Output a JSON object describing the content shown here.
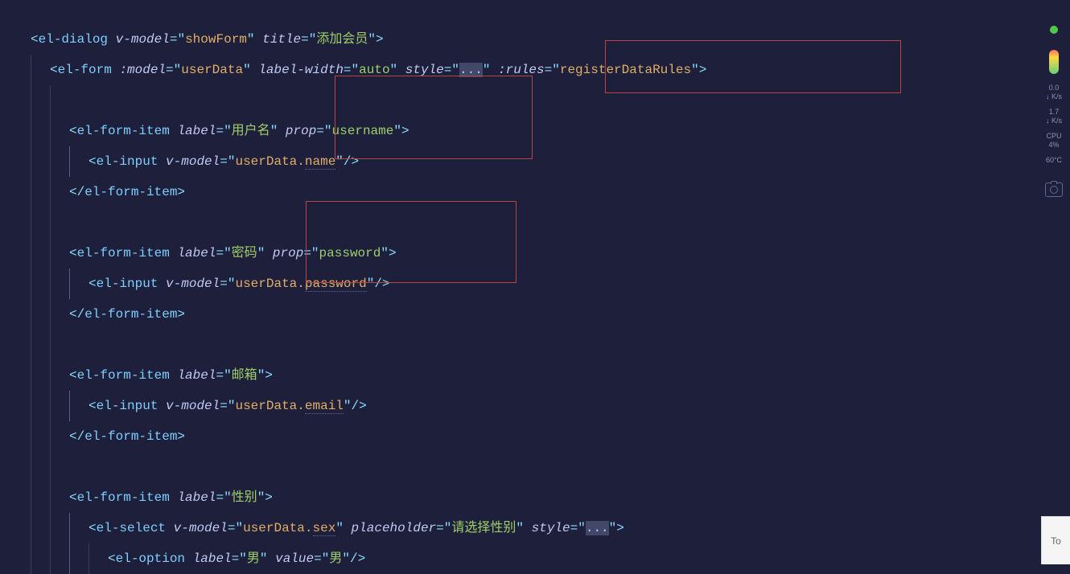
{
  "code": {
    "line1": {
      "tag": "el-dialog",
      "attr1": "v-model",
      "val1": "showForm",
      "attr2": "title",
      "val2": "添加会员"
    },
    "line2": {
      "tag": "el-form",
      "attr1": ":model",
      "val1": "userData",
      "attr2": "label-width",
      "val2": "auto",
      "attr3": "style",
      "val3": "...",
      "attr4": ":rules",
      "val4": "registerDataRules"
    },
    "line4": {
      "tag": "el-form-item",
      "attr1": "label",
      "val1": "用户名",
      "attr2": "prop",
      "val2": "username"
    },
    "line5": {
      "tag": "el-input",
      "attr1": "v-model",
      "val1a": "userData.",
      "val1b": "name"
    },
    "line6": {
      "closetag": "el-form-item"
    },
    "line8": {
      "tag": "el-form-item",
      "attr1": "label",
      "val1": "密码",
      "attr2": "prop",
      "val2": "password"
    },
    "line9": {
      "tag": "el-input",
      "attr1": "v-model",
      "val1a": "userData.",
      "val1b": "password"
    },
    "line10": {
      "closetag": "el-form-item"
    },
    "line12": {
      "tag": "el-form-item",
      "attr1": "label",
      "val1": "邮箱"
    },
    "line13": {
      "tag": "el-input",
      "attr1": "v-model",
      "val1a": "userData.",
      "val1b": "email"
    },
    "line14": {
      "closetag": "el-form-item"
    },
    "line16": {
      "tag": "el-form-item",
      "attr1": "label",
      "val1": "性别"
    },
    "line17": {
      "tag": "el-select",
      "attr1": "v-model",
      "val1a": "userData.",
      "val1b": "sex",
      "attr2": "placeholder",
      "val2": "请选择性别",
      "attr3": "style",
      "val3": "..."
    },
    "line18": {
      "tag": "el-option",
      "attr1": "label",
      "val1": "男",
      "attr2": "value",
      "val2": "男"
    }
  },
  "sidebar": {
    "net_down": "0.0",
    "net_down_unit": "K/s",
    "net_up": "1.7",
    "net_up_unit": "K/s",
    "cpu_label": "CPU",
    "cpu_value": "4",
    "cpu_pct": "%",
    "temp": "60",
    "temp_unit": "°C"
  },
  "scroll": {
    "label": "To"
  }
}
